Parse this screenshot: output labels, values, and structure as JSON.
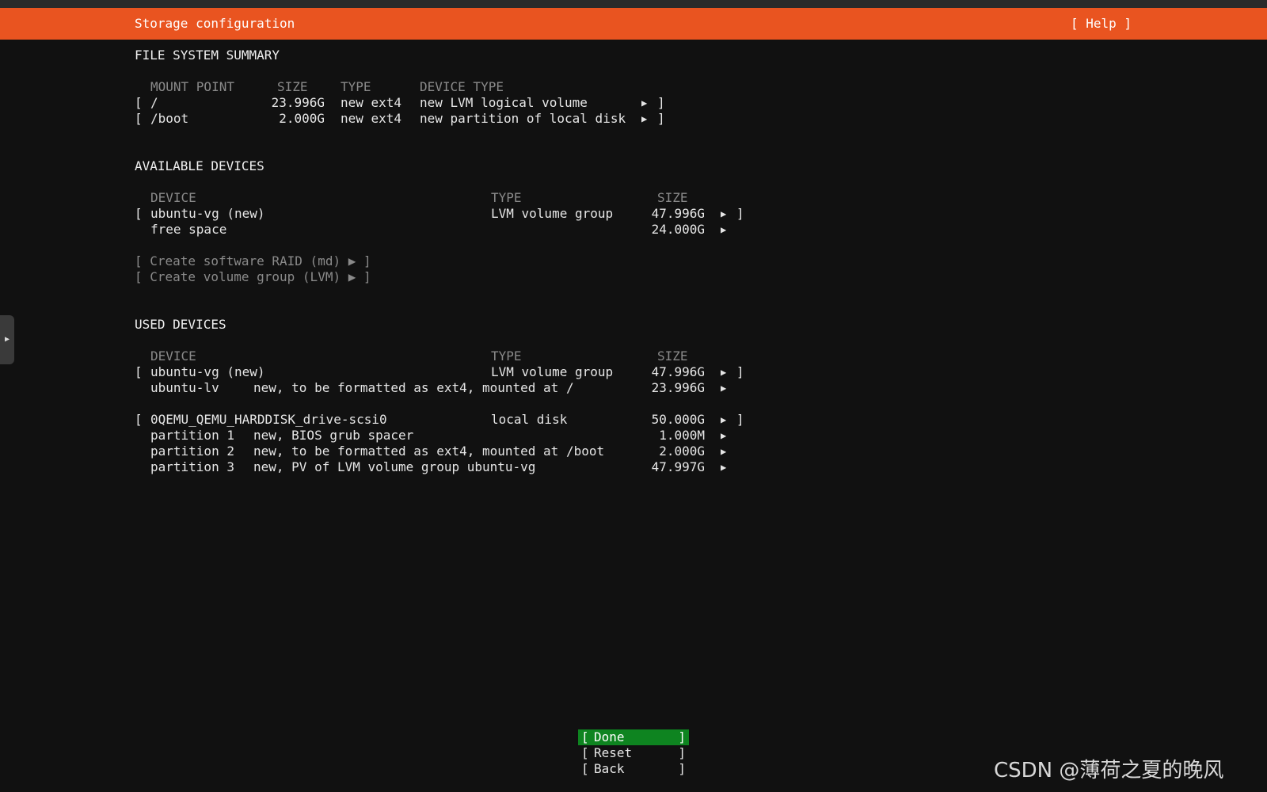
{
  "header": {
    "title": "Storage configuration",
    "help_label": "[ Help ]",
    "accent_color": "#e95420"
  },
  "side_handle": {
    "icon": "triangle-right-icon",
    "glyph": "▶"
  },
  "fs_summary": {
    "title": "FILE SYSTEM SUMMARY",
    "columns": [
      "MOUNT POINT",
      "SIZE",
      "TYPE",
      "DEVICE TYPE"
    ],
    "rows": [
      {
        "mount": "/",
        "size": "23.996G",
        "type": "new ext4",
        "device_type": "new LVM logical volume"
      },
      {
        "mount": "/boot",
        "size": "2.000G",
        "type": "new ext4",
        "device_type": "new partition of local disk"
      }
    ]
  },
  "available": {
    "title": "AVAILABLE DEVICES",
    "columns": [
      "DEVICE",
      "TYPE",
      "SIZE"
    ],
    "rows": [
      {
        "device": "ubuntu-vg (new)",
        "type": "LVM volume group",
        "size": "47.996G"
      },
      {
        "device": "free space",
        "type": "",
        "size": "24.000G"
      }
    ],
    "actions": [
      "[ Create software RAID (md) ▶ ]",
      "[ Create volume group (LVM) ▶ ]"
    ]
  },
  "used": {
    "title": "USED DEVICES",
    "columns": [
      "DEVICE",
      "TYPE",
      "SIZE"
    ],
    "groups": [
      {
        "device": "ubuntu-vg (new)",
        "type": "LVM volume group",
        "size": "47.996G",
        "children": [
          {
            "name": "ubuntu-lv",
            "desc": "new, to be formatted as ext4, mounted at /",
            "size": "23.996G"
          }
        ]
      },
      {
        "device": "0QEMU_QEMU_HARDDISK_drive-scsi0",
        "type": "local disk",
        "size": "50.000G",
        "children": [
          {
            "name": "partition 1",
            "desc": "new, BIOS grub spacer",
            "size": "1.000M"
          },
          {
            "name": "partition 2",
            "desc": "new, to be formatted as ext4, mounted at /boot",
            "size": "2.000G"
          },
          {
            "name": "partition 3",
            "desc": "new, PV of LVM volume group ubuntu-vg",
            "size": "47.997G"
          }
        ]
      }
    ]
  },
  "glyphs": {
    "open": "[",
    "close": "]",
    "arrow": "▶"
  },
  "buttons": [
    {
      "label": "Done",
      "active": true
    },
    {
      "label": "Reset",
      "active": false
    },
    {
      "label": "Back",
      "active": false
    }
  ],
  "active_button_color": "#0e8420",
  "watermark": "CSDN @薄荷之夏的晚风"
}
